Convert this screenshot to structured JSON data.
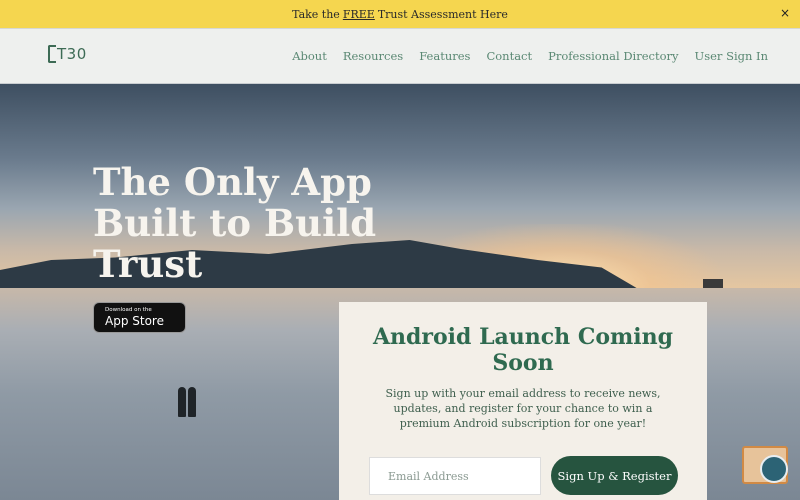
{
  "announcement": {
    "prefix": "Take the",
    "highlight": "FREE",
    "suffix": "Trust Assessment Here",
    "close": "×"
  },
  "nav": {
    "logo_text": "T30",
    "links": [
      "About",
      "Resources",
      "Features",
      "Contact",
      "Professional Directory",
      "User Sign In"
    ]
  },
  "hero": {
    "title": "The Only App Built to Build Trust",
    "appstore_small": "Download on the",
    "appstore_big": "App Store",
    "apple_glyph": ""
  },
  "signup": {
    "heading": "Android Launch Coming Soon",
    "body": "Sign up with your email address to receive news, updates, and register for your chance to win a premium Android subscription for one year!",
    "email_placeholder": "Email Address",
    "email_value": "",
    "button": "Sign Up & Register"
  },
  "colors": {
    "announcement_bg": "#f5d64f",
    "brand_green": "#26543f",
    "heading_green": "#2f6a50"
  },
  "icons": [
    "close-icon",
    "apple-icon",
    "chat-icon"
  ]
}
